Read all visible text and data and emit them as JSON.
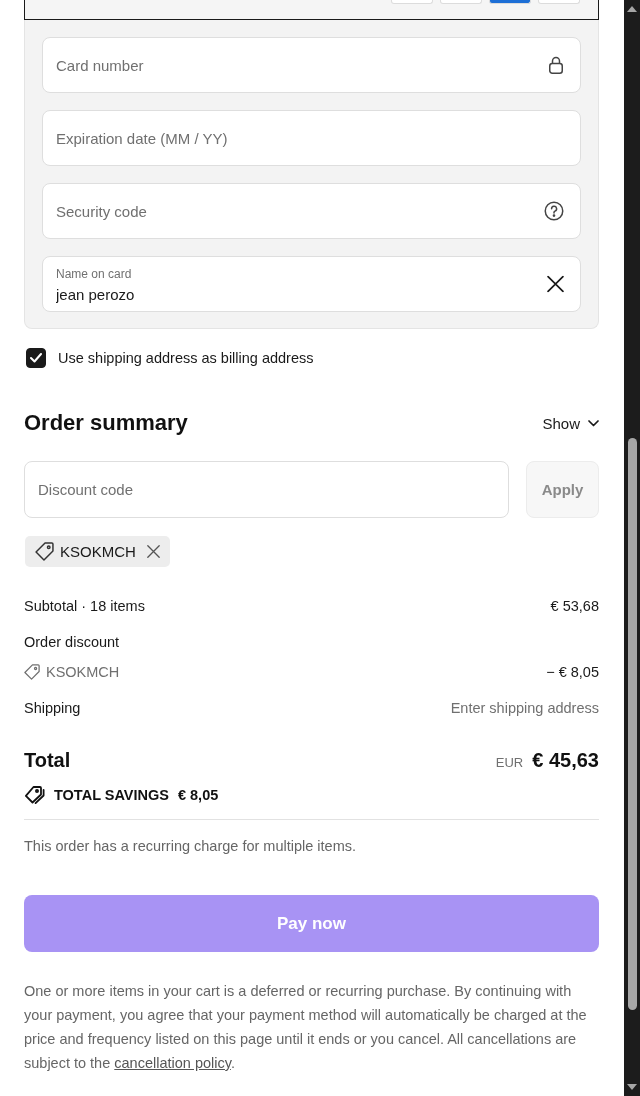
{
  "payment_method": {
    "selected": true
  },
  "card_fields": [
    {
      "kind": "lock",
      "placeholder": "Card number"
    },
    {
      "kind": "plain",
      "placeholder": "Expiration date (MM / YY)"
    },
    {
      "kind": "help",
      "placeholder": "Security code"
    },
    {
      "kind": "clear",
      "label": "Name on card",
      "value": "jean perozo"
    }
  ],
  "billing_address_option": {
    "label": "Use shipping address as billing address",
    "checked": true
  },
  "order_summary": {
    "title": "Order summary",
    "toggle": {
      "label": "Show",
      "expanded": false
    }
  },
  "discount": {
    "placeholder": "Discount code",
    "button": {
      "label": "Apply",
      "disabled": true
    },
    "applied_codes": [
      {
        "code": "KSOKMCH"
      }
    ]
  },
  "summary_lines": [
    {
      "kind": "amount",
      "label": "Subtotal · 18 items",
      "value": "€ 53,68"
    },
    {
      "kind": "heading",
      "label": "Order discount"
    },
    {
      "kind": "code",
      "label": "KSOKMCH",
      "value": "− € 8,05"
    },
    {
      "kind": "pending",
      "label": "Shipping",
      "value": "Enter shipping address"
    }
  ],
  "total": {
    "label": "Total",
    "currency": "EUR",
    "amount": "€ 45,63"
  },
  "savings": {
    "label": "TOTAL SAVINGS",
    "amount": "€ 8,05"
  },
  "recurring_note": "This order has a recurring charge for multiple items.",
  "pay_button": {
    "label": "Pay now"
  },
  "disclaimer": {
    "text": "One or more items in your cart is a deferred or recurring purchase. By continuing with your payment, you agree that your payment method will automatically be charged at the price and frequency listed on this page until it ends or you cancel. All cancellations are subject to the ",
    "link": "cancellation policy",
    "end": "."
  }
}
